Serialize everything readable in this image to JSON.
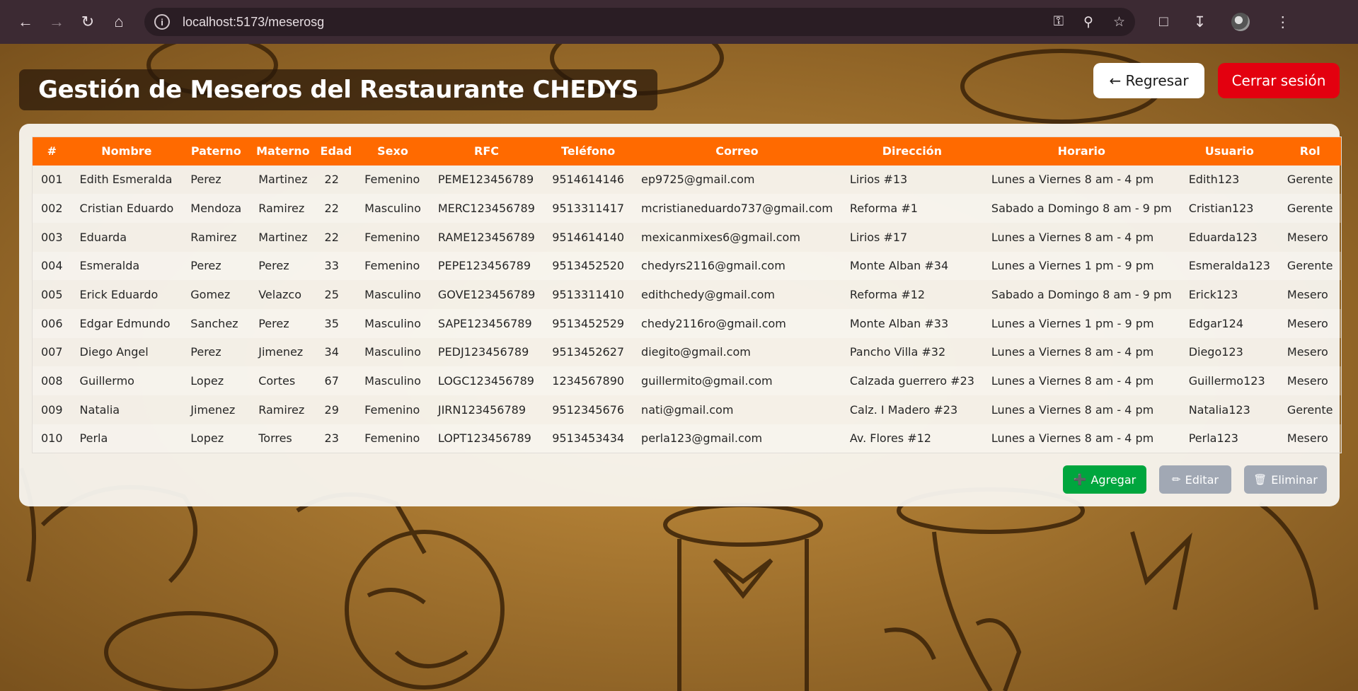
{
  "browser": {
    "url": "localhost:5173/meserosg",
    "icons": [
      "back-icon",
      "forward-icon",
      "reload-icon",
      "home-icon",
      "site-info-icon",
      "password-key-icon",
      "zoom-icon",
      "bookmark-star-icon",
      "extensions-icon",
      "download-icon",
      "profile-avatar",
      "menu-icon"
    ]
  },
  "header": {
    "title": "Gestión de Meseros del Restaurante CHEDYS",
    "back_label": "← Regresar",
    "logout_label": "Cerrar sesión"
  },
  "table": {
    "columns": [
      "#",
      "Nombre",
      "Paterno",
      "Materno",
      "Edad",
      "Sexo",
      "RFC",
      "Teléfono",
      "Correo",
      "Dirección",
      "Horario",
      "Usuario",
      "Rol"
    ],
    "rows": [
      [
        "001",
        "Edith Esmeralda",
        "Perez",
        "Martinez",
        "22",
        "Femenino",
        "PEME123456789",
        "9514614146",
        "ep9725@gmail.com",
        "Lirios #13",
        "Lunes a Viernes 8 am - 4 pm",
        "Edith123",
        "Gerente"
      ],
      [
        "002",
        "Cristian Eduardo",
        "Mendoza",
        "Ramirez",
        "22",
        "Masculino",
        "MERC123456789",
        "9513311417",
        "mcristianeduardo737@gmail.com",
        "Reforma #1",
        "Sabado a Domingo 8 am - 9 pm",
        "Cristian123",
        "Gerente"
      ],
      [
        "003",
        "Eduarda",
        "Ramirez",
        "Martinez",
        "22",
        "Femenino",
        "RAME123456789",
        "9514614140",
        "mexicanmixes6@gmail.com",
        "Lirios #17",
        "Lunes a Viernes 8 am - 4 pm",
        "Eduarda123",
        "Mesero"
      ],
      [
        "004",
        "Esmeralda",
        "Perez",
        "Perez",
        "33",
        "Femenino",
        "PEPE123456789",
        "9513452520",
        "chedyrs2116@gmail.com",
        "Monte Alban #34",
        "Lunes a Viernes 1 pm - 9 pm",
        "Esmeralda123",
        "Gerente"
      ],
      [
        "005",
        "Erick Eduardo",
        "Gomez",
        "Velazco",
        "25",
        "Masculino",
        "GOVE123456789",
        "9513311410",
        "edithchedy@gmail.com",
        "Reforma #12",
        "Sabado a Domingo 8 am - 9 pm",
        "Erick123",
        "Mesero"
      ],
      [
        "006",
        "Edgar Edmundo",
        "Sanchez",
        "Perez",
        "35",
        "Masculino",
        "SAPE123456789",
        "9513452529",
        "chedy2116ro@gmail.com",
        "Monte Alban #33",
        "Lunes a Viernes 1 pm - 9 pm",
        "Edgar124",
        "Mesero"
      ],
      [
        "007",
        "Diego Angel",
        "Perez",
        "Jimenez",
        "34",
        "Masculino",
        "PEDJ123456789",
        "9513452627",
        "diegito@gmail.com",
        "Pancho Villa #32",
        "Lunes a Viernes 8 am - 4 pm",
        "Diego123",
        "Mesero"
      ],
      [
        "008",
        "Guillermo",
        "Lopez",
        "Cortes",
        "67",
        "Masculino",
        "LOGC123456789",
        "1234567890",
        "guillermito@gmail.com",
        "Calzada guerrero #23",
        "Lunes a Viernes 8 am - 4 pm",
        "Guillermo123",
        "Mesero"
      ],
      [
        "009",
        "Natalia",
        "Jimenez",
        "Ramirez",
        "29",
        "Femenino",
        "JIRN123456789",
        "9512345676",
        "nati@gmail.com",
        "Calz. I Madero #23",
        "Lunes a Viernes 8 am - 4 pm",
        "Natalia123",
        "Gerente"
      ],
      [
        "010",
        "Perla",
        "Lopez",
        "Torres",
        "23",
        "Femenino",
        "LOPT123456789",
        "9513453434",
        "perla123@gmail.com",
        "Av. Flores #12",
        "Lunes a Viernes 8 am - 4 pm",
        "Perla123",
        "Mesero"
      ]
    ]
  },
  "actions": {
    "add_label": "Agregar",
    "edit_label": "Editar",
    "delete_label": "Eliminar"
  },
  "colors": {
    "header_orange": "#ff6a00",
    "logout_red": "#e3000f",
    "add_green": "#00a63e",
    "disabled_gray": "#a1a8b4"
  }
}
